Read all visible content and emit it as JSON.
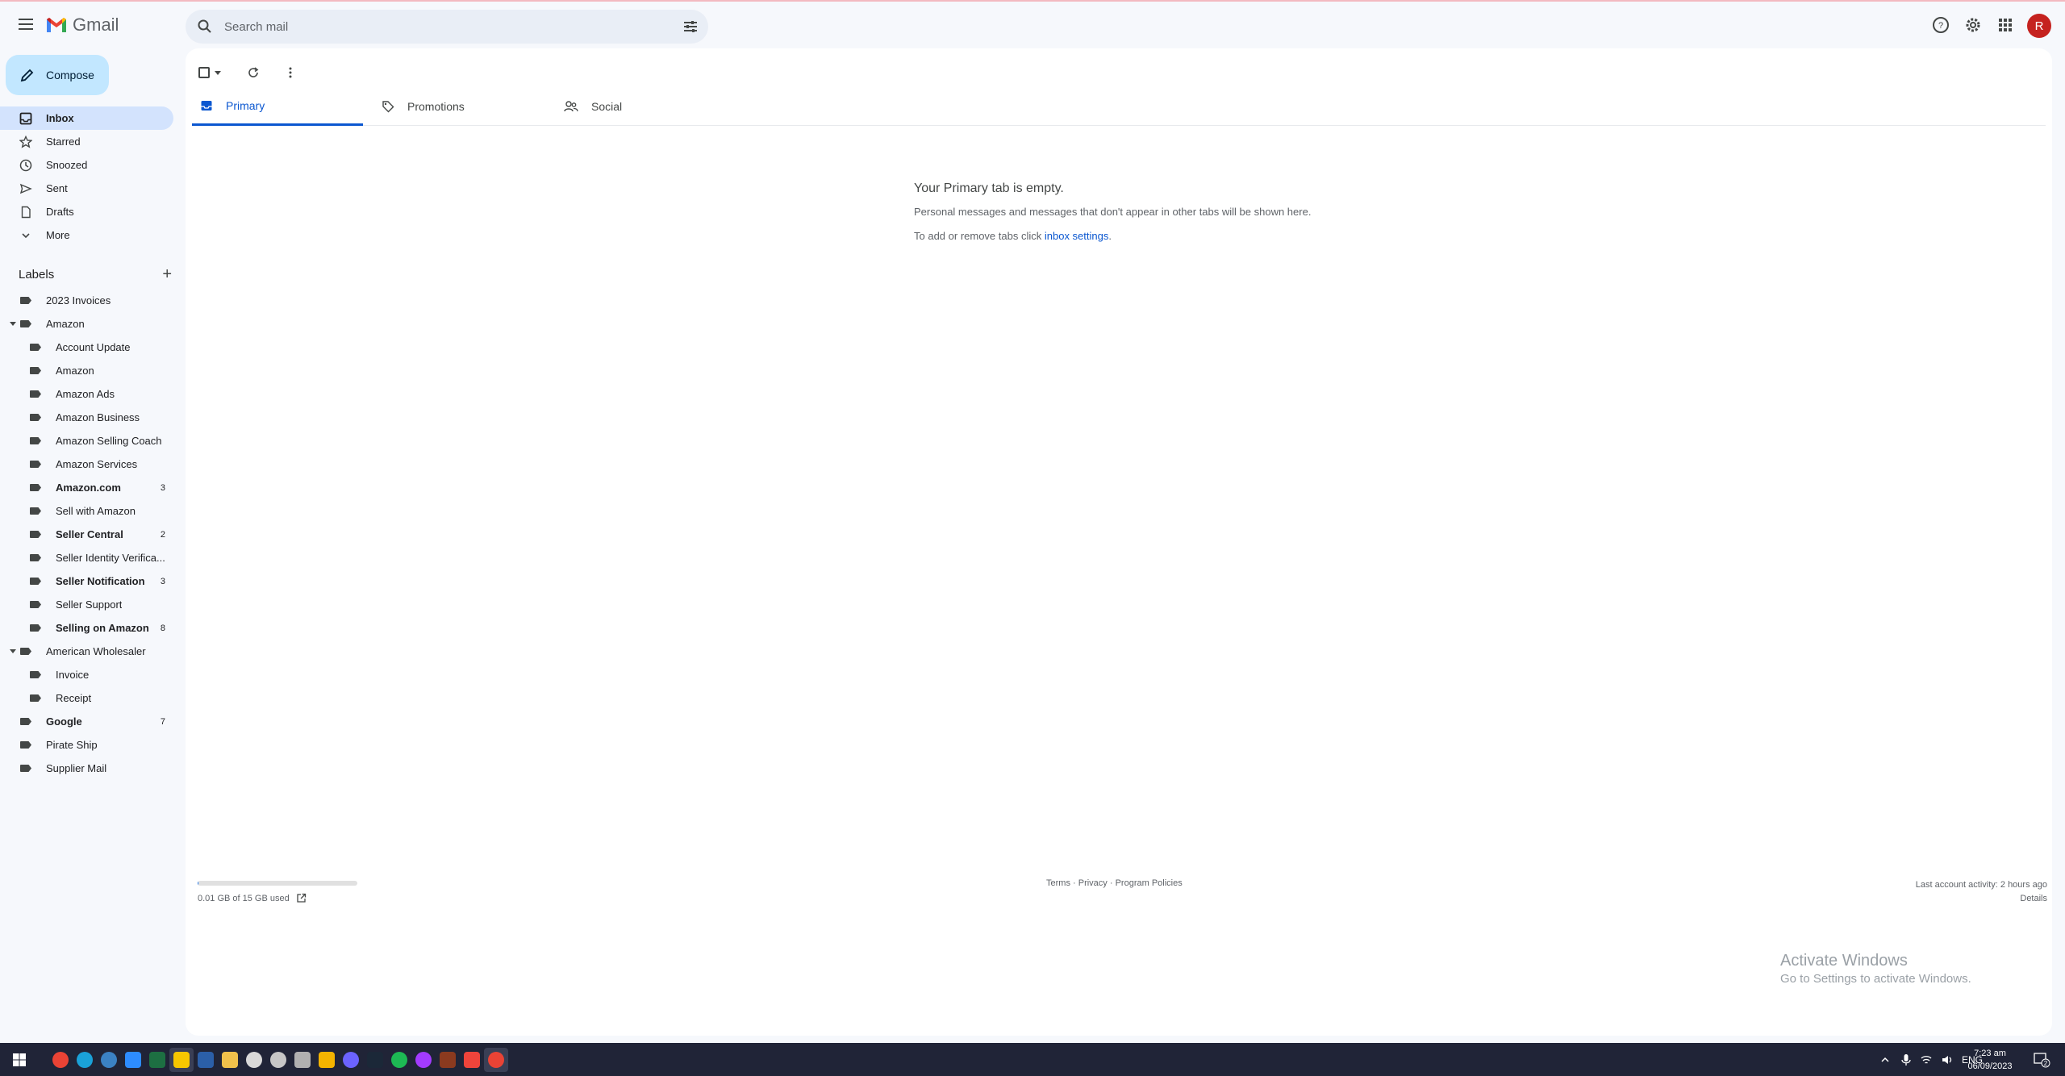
{
  "app": {
    "logo_text": "Gmail",
    "avatar_letter": "R"
  },
  "search": {
    "placeholder": "Search mail"
  },
  "compose": {
    "label": "Compose"
  },
  "nav": [
    {
      "label": "Inbox",
      "icon": "inbox-icon",
      "active": true
    },
    {
      "label": "Starred",
      "icon": "star-icon"
    },
    {
      "label": "Snoozed",
      "icon": "clock-icon"
    },
    {
      "label": "Sent",
      "icon": "send-icon"
    },
    {
      "label": "Drafts",
      "icon": "draft-icon"
    },
    {
      "label": "More",
      "icon": "chevron-down-icon"
    }
  ],
  "labels_title": "Labels",
  "labels": [
    {
      "label": "2023 Invoices",
      "count": ""
    },
    {
      "label": "Amazon",
      "count": ""
    },
    {
      "label": "Account Update",
      "count": ""
    },
    {
      "label": "Amazon",
      "count": ""
    },
    {
      "label": "Amazon Ads",
      "count": ""
    },
    {
      "label": "Amazon Business",
      "count": ""
    },
    {
      "label": "Amazon Selling Coach",
      "count": ""
    },
    {
      "label": "Amazon Services",
      "count": ""
    },
    {
      "label": "Amazon.com",
      "count": "3"
    },
    {
      "label": "Sell with Amazon",
      "count": ""
    },
    {
      "label": "Seller Central",
      "count": "2"
    },
    {
      "label": "Seller Identity Verifica...",
      "count": ""
    },
    {
      "label": "Seller Notification",
      "count": "3"
    },
    {
      "label": "Seller Support",
      "count": ""
    },
    {
      "label": "Selling on Amazon",
      "count": "8"
    },
    {
      "label": "American Wholesaler",
      "count": ""
    },
    {
      "label": "Invoice",
      "count": ""
    },
    {
      "label": "Receipt",
      "count": ""
    },
    {
      "label": "Google",
      "count": "7"
    },
    {
      "label": "Pirate Ship",
      "count": ""
    },
    {
      "label": "Supplier Mail",
      "count": ""
    }
  ],
  "tabs": [
    {
      "label": "Primary",
      "icon": "inbox-icon",
      "active": true
    },
    {
      "label": "Promotions",
      "icon": "tag-icon"
    },
    {
      "label": "Social",
      "icon": "people-icon"
    }
  ],
  "empty_state": {
    "title": "Your Primary tab is empty.",
    "line1": "Personal messages and messages that don't appear in other tabs will be shown here.",
    "line2_prefix": "To add or remove tabs click ",
    "line2_link": "inbox settings",
    "line2_suffix": "."
  },
  "footer": {
    "storage_used": "0.01 GB of 15 GB used",
    "storage_fraction": 0.001,
    "terms": "Terms",
    "privacy": "Privacy",
    "policies": "Program Policies",
    "sep": " · ",
    "last_activity": "Last account activity: 2 hours ago",
    "details": "Details"
  },
  "watermark": {
    "title": "Activate Windows",
    "subtitle": "Go to Settings to activate Windows."
  },
  "taskbar": {
    "apps": [
      {
        "name": "chrome",
        "color": "#ea4335"
      },
      {
        "name": "edge",
        "color": "#1aa1d8"
      },
      {
        "name": "app-badge",
        "color": "#3b82c4"
      },
      {
        "name": "zoom",
        "color": "#2d8cff"
      },
      {
        "name": "excel",
        "color": "#1d6f42"
      },
      {
        "name": "sticky-notes",
        "color": "#f7c600"
      },
      {
        "name": "calculator",
        "color": "#2b5fa8"
      },
      {
        "name": "file-explorer",
        "color": "#f0c14b"
      },
      {
        "name": "clock-app",
        "color": "#d9d9d9"
      },
      {
        "name": "settings-app",
        "color": "#c7c7c7"
      },
      {
        "name": "cube-app",
        "color": "#b0b0b0"
      },
      {
        "name": "yellow-app",
        "color": "#f4b400"
      },
      {
        "name": "chat-app",
        "color": "#6c63ff"
      },
      {
        "name": "steam",
        "color": "#1b2838"
      },
      {
        "name": "spotify",
        "color": "#1db954"
      },
      {
        "name": "messenger",
        "color": "#a33bff"
      },
      {
        "name": "game-app",
        "color": "#8b3a1f"
      },
      {
        "name": "anydesk",
        "color": "#ef443b"
      },
      {
        "name": "chrome-active",
        "color": "#ea4335"
      }
    ],
    "lang": "ENG",
    "time": "7:23 am",
    "date": "06/09/2023",
    "notif_count": "2"
  }
}
